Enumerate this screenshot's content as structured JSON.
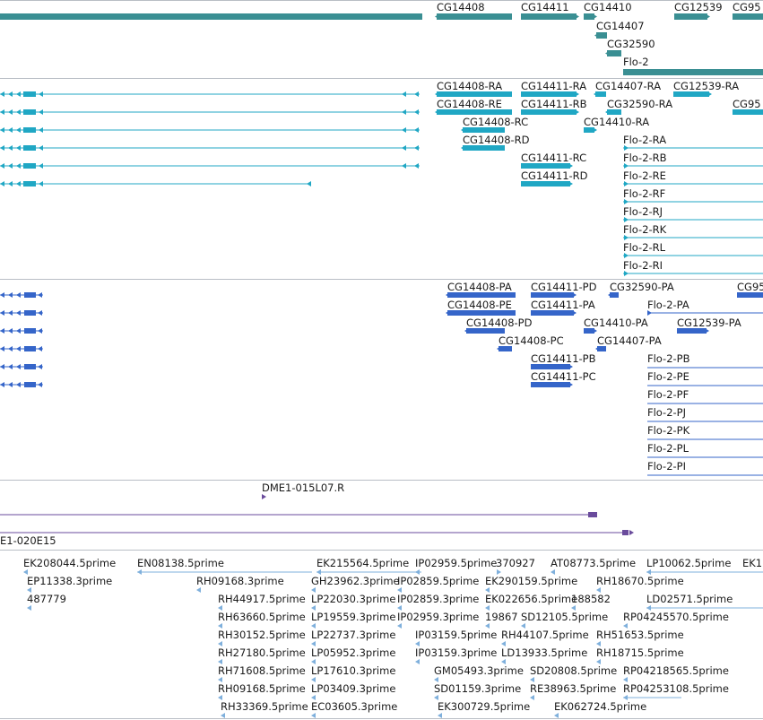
{
  "colors": {
    "gene": "#3a8f93",
    "transcript": "#20a7c4",
    "protein": "#3565c9",
    "clone": "#6a4b9c",
    "est": "#7fb0dc",
    "divider": "#b9bec5",
    "label": "#1a1a1a"
  },
  "tracks": {
    "gene": {
      "features": [
        {
          "label": "CG14408"
        },
        {
          "label": "CG14411"
        },
        {
          "label": "CG14410"
        },
        {
          "label": "CG12539"
        },
        {
          "label": "CG95"
        },
        {
          "label": "CG14407"
        },
        {
          "label": "CG32590"
        },
        {
          "label": "Flo-2"
        }
      ]
    },
    "transcript": {
      "features": [
        {
          "label": "CG14408-RA"
        },
        {
          "label": "CG14411-RA"
        },
        {
          "label": "CG14407-RA"
        },
        {
          "label": "CG12539-RA"
        },
        {
          "label": "CG14408-RE"
        },
        {
          "label": "CG14411-RB"
        },
        {
          "label": "CG32590-RA"
        },
        {
          "label": "CG95"
        },
        {
          "label": "CG14408-RC"
        },
        {
          "label": "CG14410-RA"
        },
        {
          "label": "CG14408-RD"
        },
        {
          "label": "Flo-2-RA"
        },
        {
          "label": "CG14411-RC"
        },
        {
          "label": "Flo-2-RB"
        },
        {
          "label": "CG14411-RD"
        },
        {
          "label": "Flo-2-RE"
        },
        {
          "label": "Flo-2-RF"
        },
        {
          "label": "Flo-2-RJ"
        },
        {
          "label": "Flo-2-RK"
        },
        {
          "label": "Flo-2-RL"
        },
        {
          "label": "Flo-2-RI"
        }
      ]
    },
    "protein": {
      "features": [
        {
          "label": "CG14408-PA"
        },
        {
          "label": "CG14411-PD"
        },
        {
          "label": "CG32590-PA"
        },
        {
          "label": "CG95"
        },
        {
          "label": "CG14408-PE"
        },
        {
          "label": "CG14411-PA"
        },
        {
          "label": "Flo-2-PA"
        },
        {
          "label": "CG14408-PD"
        },
        {
          "label": "CG14410-PA"
        },
        {
          "label": "CG12539-PA"
        },
        {
          "label": "CG14408-PC"
        },
        {
          "label": "CG14407-PA"
        },
        {
          "label": "CG14411-PB"
        },
        {
          "label": "Flo-2-PB"
        },
        {
          "label": "CG14411-PC"
        },
        {
          "label": "Flo-2-PE"
        },
        {
          "label": "Flo-2-PF"
        },
        {
          "label": "Flo-2-PJ"
        },
        {
          "label": "Flo-2-PK"
        },
        {
          "label": "Flo-2-PL"
        },
        {
          "label": "Flo-2-PI"
        }
      ]
    },
    "clone": {
      "features": [
        {
          "label": "DME1-015L07.R"
        },
        {
          "label": "E1-020E15"
        }
      ]
    },
    "est": {
      "features": [
        {
          "label": "EK208044.5prime"
        },
        {
          "label": "EN08138.5prime"
        },
        {
          "label": "EK215564.5prime"
        },
        {
          "label": "IP02959.5prime"
        },
        {
          "label": "370927"
        },
        {
          "label": "AT08773.5prime"
        },
        {
          "label": "LP10062.5prime"
        },
        {
          "label": "EK1"
        },
        {
          "label": "EP11338.3prime"
        },
        {
          "label": "RH09168.3prime"
        },
        {
          "label": "GH23962.3prime"
        },
        {
          "label": "IP02859.5prime"
        },
        {
          "label": "EK290159.5prime"
        },
        {
          "label": "RH18670.5prime"
        },
        {
          "label": "487779"
        },
        {
          "label": "RH44917.5prime"
        },
        {
          "label": "LP22030.3prime"
        },
        {
          "label": "IP02859.3prime"
        },
        {
          "label": "EK022656.5prime"
        },
        {
          "label": "188582"
        },
        {
          "label": "LD02571.5prime"
        },
        {
          "label": "RH63660.5prime"
        },
        {
          "label": "LP19559.3prime"
        },
        {
          "label": "IP02959.3prime"
        },
        {
          "label": "19867"
        },
        {
          "label": "SD12105.5prime"
        },
        {
          "label": "RP04245570.5prime"
        },
        {
          "label": "RH30152.5prime"
        },
        {
          "label": "LP22737.3prime"
        },
        {
          "label": "IP03159.5prime"
        },
        {
          "label": "RH44107.5prime"
        },
        {
          "label": "RH51653.5prime"
        },
        {
          "label": "RH27180.5prime"
        },
        {
          "label": "LP05952.3prime"
        },
        {
          "label": "IP03159.3prime"
        },
        {
          "label": "LD13933.5prime"
        },
        {
          "label": "RH18715.5prime"
        },
        {
          "label": "RH71608.5prime"
        },
        {
          "label": "LP17610.3prime"
        },
        {
          "label": "GM05493.3prime"
        },
        {
          "label": "SD20808.5prime"
        },
        {
          "label": "RP04218565.5prime"
        },
        {
          "label": "RH09168.5prime"
        },
        {
          "label": "LP03409.3prime"
        },
        {
          "label": "SD01159.3prime"
        },
        {
          "label": "RE38963.5prime"
        },
        {
          "label": "RP04253108.5prime"
        },
        {
          "label": "RH33369.5prime"
        },
        {
          "label": "EC03605.3prime"
        },
        {
          "label": "EK300729.5prime"
        },
        {
          "label": "EK062724.5prime"
        }
      ]
    }
  }
}
